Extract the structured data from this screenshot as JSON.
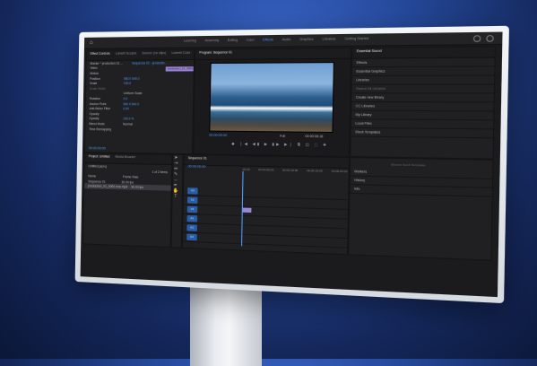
{
  "workspace_tabs": [
    "Learning",
    "Assembly",
    "Editing",
    "Color",
    "Effects",
    "Audio",
    "Graphics",
    "Libraries",
    "Getting Started"
  ],
  "active_workspace": "Effects",
  "effect_controls": {
    "tabs": [
      "Effect Controls",
      "Lumetri Scopes",
      "Source: (no clips)",
      "Lumetri Color"
    ],
    "source_label": "Master * production.01 ...",
    "sequence_label": "Sequence 01 - productio...",
    "rows": [
      {
        "label": "Video",
        "value": ""
      },
      {
        "label": "Motion",
        "value": ""
      },
      {
        "label": "Position",
        "value": "960.0   540.0"
      },
      {
        "label": "Scale",
        "value": "100.0"
      },
      {
        "label": "Scale Width",
        "value": ""
      },
      {
        "label": "",
        "value": "Uniform Scale"
      },
      {
        "label": "Rotation",
        "value": "0.0"
      },
      {
        "label": "Anchor Point",
        "value": "960.0   540.0"
      },
      {
        "label": "Anti-flicker Filter",
        "value": "0.00"
      },
      {
        "label": "Opacity",
        "value": ""
      },
      {
        "label": "Opacity",
        "value": "100.0 %"
      },
      {
        "label": "Blend Mode",
        "value": "Normal"
      },
      {
        "label": "Time Remapping",
        "value": ""
      }
    ],
    "clip_label": "production_01_0000.mov.mp4",
    "timecode": "00:00:00:00"
  },
  "program_monitor": {
    "title": "Program: Sequence 01",
    "timecode_left": "00:00:00:00",
    "fit": "Full",
    "timecode_right": "00:00:08:18"
  },
  "effects_panel": {
    "title": "Essential Sound",
    "tabs": [
      "Effects",
      "Essential Graphics",
      "Libraries"
    ],
    "search_placeholder": "Search All Libraries",
    "items": [
      "Create new library",
      "CC Libraries",
      "My Library",
      "Local Files",
      "Stock Templates",
      "Lookbook"
    ],
    "info_text": "Browse Stock Templates"
  },
  "project_panel": {
    "tabs": [
      "Project: Untitled",
      "Media Browser"
    ],
    "path": "Untitled.prproj",
    "items_count": "1 of 2 items",
    "columns": [
      "Name",
      "Frame Rate"
    ],
    "rows": [
      {
        "name": "Sequence 01",
        "rate": "30.00 fps"
      },
      {
        "name": "production_01_0000.mov.mp4",
        "rate": "30.00 fps"
      }
    ]
  },
  "timeline": {
    "title": "Sequence 01",
    "timecode": "00:00:00:00",
    "ruler": [
      "00:00",
      "00:00:05:00",
      "00:00:10:00",
      "00:00:15:00",
      "00:00:20:00",
      "00:00:25:00"
    ],
    "tracks": [
      "V3",
      "V2",
      "V1",
      "A1",
      "A2",
      "A3"
    ]
  },
  "right_lower": {
    "items": [
      "Markers",
      "History",
      "Info"
    ]
  }
}
